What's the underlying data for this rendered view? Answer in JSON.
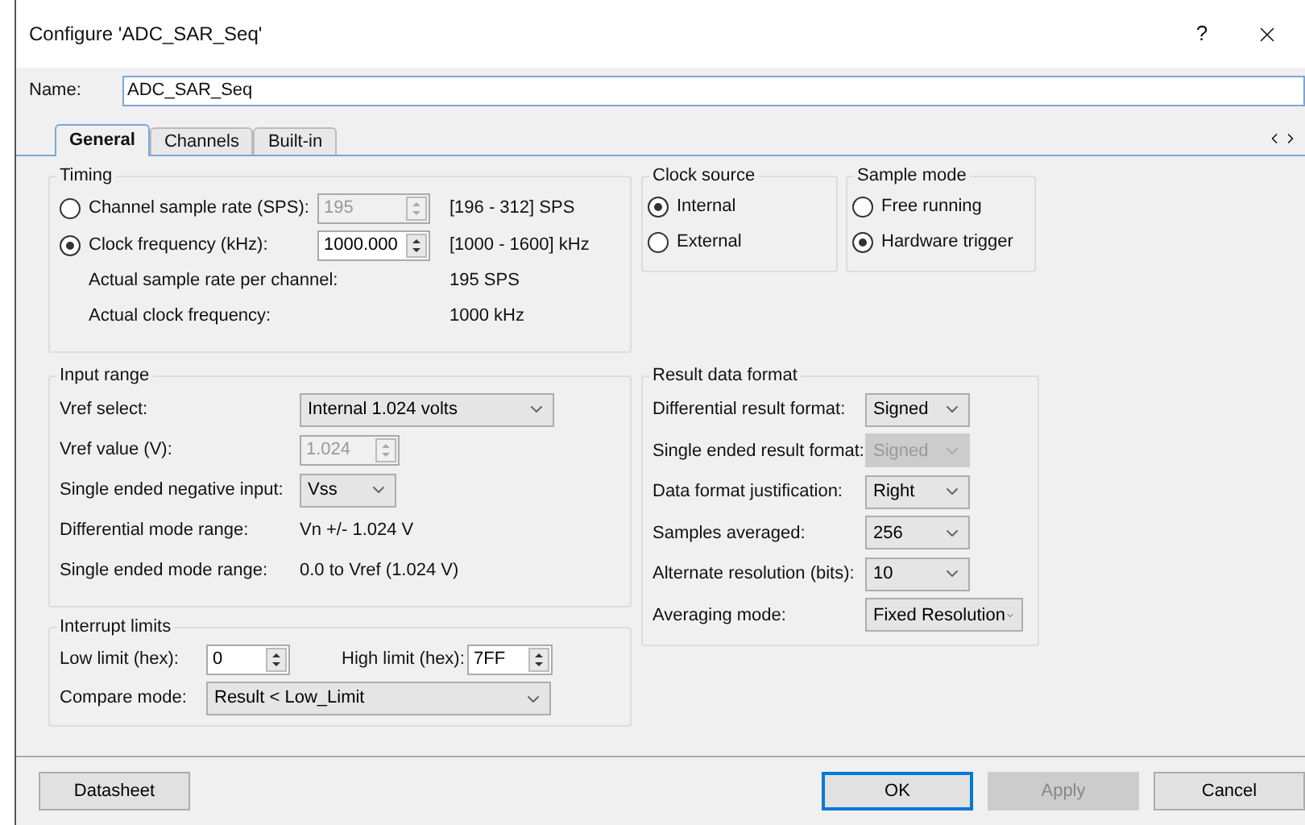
{
  "window": {
    "title": "Configure 'ADC_SAR_Seq'",
    "help": "?"
  },
  "name_field": {
    "label": "Name:",
    "value": "ADC_SAR_Seq"
  },
  "tabs": [
    {
      "label": "General",
      "selected": true
    },
    {
      "label": "Channels",
      "selected": false
    },
    {
      "label": "Built-in",
      "selected": false
    }
  ],
  "timing": {
    "title": "Timing",
    "options": [
      {
        "label": "Channel sample rate (SPS):",
        "selected": false,
        "value": "195",
        "disabled": true,
        "range": "[196 - 312] SPS"
      },
      {
        "label": "Clock frequency (kHz):",
        "selected": true,
        "value": "1000.000",
        "disabled": false,
        "range": "[1000 - 1600] kHz"
      }
    ],
    "readouts": [
      {
        "label": "Actual sample rate per channel:",
        "value": "195 SPS"
      },
      {
        "label": "Actual clock frequency:",
        "value": "1000 kHz"
      }
    ]
  },
  "clock_source": {
    "title": "Clock source",
    "options": [
      {
        "label": "Internal",
        "selected": true
      },
      {
        "label": "External",
        "selected": false
      }
    ]
  },
  "sample_mode": {
    "title": "Sample mode",
    "options": [
      {
        "label": "Free running",
        "selected": false
      },
      {
        "label": "Hardware trigger",
        "selected": true
      }
    ]
  },
  "input_range": {
    "title": "Input range",
    "rows": [
      {
        "kind": "select",
        "label": "Vref select:",
        "value": "Internal 1.024 volts",
        "disabled": false
      },
      {
        "kind": "spin",
        "label": "Vref value (V):",
        "value": "1.024",
        "disabled": true
      },
      {
        "kind": "select",
        "label": "Single ended negative input:",
        "value": "Vss",
        "disabled": false
      },
      {
        "kind": "text",
        "label": "Differential mode range:",
        "value": "Vn +/- 1.024 V"
      },
      {
        "kind": "text",
        "label": "Single ended mode range:",
        "value": "0.0 to Vref (1.024 V)"
      }
    ]
  },
  "interrupt_limits": {
    "title": "Interrupt limits",
    "low": {
      "label": "Low limit (hex):",
      "value": "0"
    },
    "high": {
      "label": "High limit (hex):",
      "value": "7FF"
    },
    "compare": {
      "label": "Compare mode:",
      "value": "Result < Low_Limit"
    }
  },
  "result_format": {
    "title": "Result data format",
    "rows": [
      {
        "label": "Differential result format:",
        "value": "Signed",
        "disabled": false
      },
      {
        "label": "Single ended result format:",
        "value": "Signed",
        "disabled": true
      },
      {
        "label": "Data format justification:",
        "value": "Right",
        "disabled": false
      },
      {
        "label": "Samples averaged:",
        "value": "256",
        "disabled": false
      },
      {
        "label": "Alternate resolution (bits):",
        "value": "10",
        "disabled": false
      },
      {
        "label": "Averaging mode:",
        "value": "Fixed Resolution",
        "disabled": false
      }
    ]
  },
  "buttons": [
    {
      "label": "Datasheet",
      "disabled": false,
      "default": false
    },
    {
      "label": "OK",
      "disabled": false,
      "default": true
    },
    {
      "label": "Apply",
      "disabled": true,
      "default": false
    },
    {
      "label": "Cancel",
      "disabled": false,
      "default": false
    }
  ]
}
